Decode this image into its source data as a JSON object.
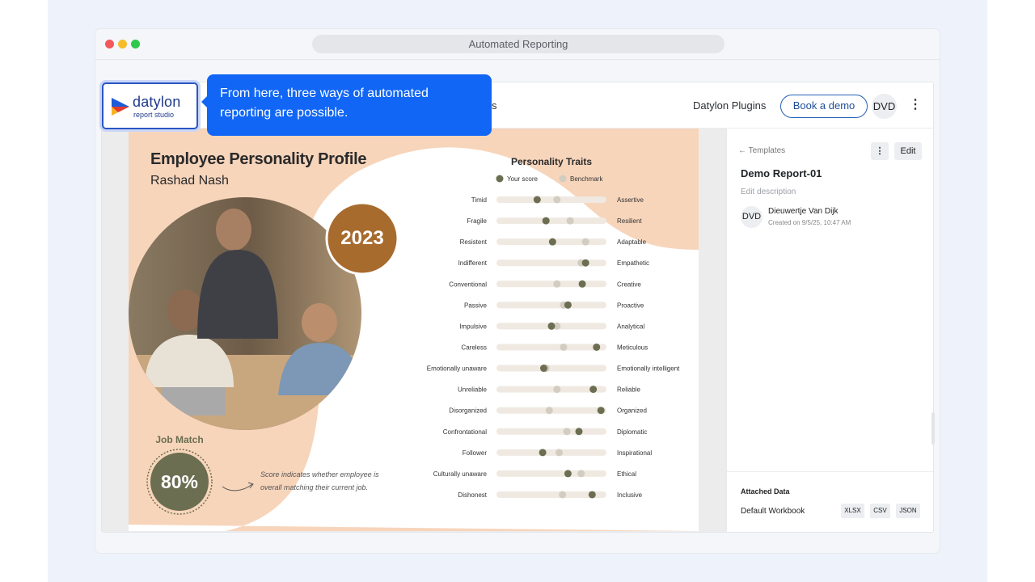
{
  "window": {
    "url_title": "Automated Reporting"
  },
  "logo": {
    "name": "datylon",
    "subtitle": "report studio"
  },
  "tooltip": {
    "text": "From here, three ways of automated reporting are possible."
  },
  "topnav": {
    "partial_item": "s",
    "plugins": "Datylon Plugins",
    "book_demo": "Book a demo",
    "avatar": "DVD"
  },
  "report": {
    "title": "Employee Personality Profile",
    "name": "Rashad Nash",
    "year": "2023",
    "job_match_label": "Job Match",
    "job_match_value": "80%",
    "job_match_fraction": 0.8,
    "score_note_1": "Score indicates whether employee is",
    "score_note_2": "overall matching their current job."
  },
  "side": {
    "back": "Templates",
    "edit": "Edit",
    "report_name": "Demo Report-01",
    "edit_description": "Edit description",
    "avatar": "DVD",
    "owner": "Dieuwertje Van Dijk",
    "created": "Created on 9/5/25, 10:47 AM",
    "attached_title": "Attached Data",
    "workbook": "Default Workbook",
    "formats": [
      "XLSX",
      "CSV",
      "JSON"
    ]
  },
  "chart_data": {
    "type": "scatter",
    "title": "Personality Traits",
    "legend": [
      {
        "name": "Your score",
        "color": "#6b6e50"
      },
      {
        "name": "Benchmark",
        "color": "#d3ccc0"
      }
    ],
    "legend_position": "top",
    "xlim": [
      0,
      100
    ],
    "rows": [
      {
        "left": "Timid",
        "right": "Assertive",
        "score": 37,
        "benchmark": 55
      },
      {
        "left": "Fragile",
        "right": "Resilient",
        "score": 45,
        "benchmark": 67
      },
      {
        "left": "Resistent",
        "right": "Adaptable",
        "score": 51,
        "benchmark": 81
      },
      {
        "left": "Indifferent",
        "right": "Empathetic",
        "score": 81,
        "benchmark": 77
      },
      {
        "left": "Conventional",
        "right": "Creative",
        "score": 78,
        "benchmark": 55
      },
      {
        "left": "Passive",
        "right": "Proactive",
        "score": 65,
        "benchmark": 61
      },
      {
        "left": "Impulsive",
        "right": "Analytical",
        "score": 50,
        "benchmark": 55
      },
      {
        "left": "Careless",
        "right": "Meticulous",
        "score": 91,
        "benchmark": 61
      },
      {
        "left": "Emotionally unaware",
        "right": "Emotionally intelligent",
        "score": 43,
        "benchmark": 45
      },
      {
        "left": "Unreliable",
        "right": "Reliable",
        "score": 88,
        "benchmark": 55
      },
      {
        "left": "Disorganized",
        "right": "Organized",
        "score": 95,
        "benchmark": 48
      },
      {
        "left": "Confrontational",
        "right": "Diplomatic",
        "score": 75,
        "benchmark": 64
      },
      {
        "left": "Follower",
        "right": "Inspirational",
        "score": 42,
        "benchmark": 57
      },
      {
        "left": "Culturally unaware",
        "right": "Ethical",
        "score": 65,
        "benchmark": 77
      },
      {
        "left": "Dishonest",
        "right": "Inclusive",
        "score": 87,
        "benchmark": 60
      }
    ]
  },
  "colors": {
    "accent": "#1166f5",
    "olive": "#6b6e50",
    "brown": "#a86b2e",
    "peach": "#f7d5bb"
  }
}
